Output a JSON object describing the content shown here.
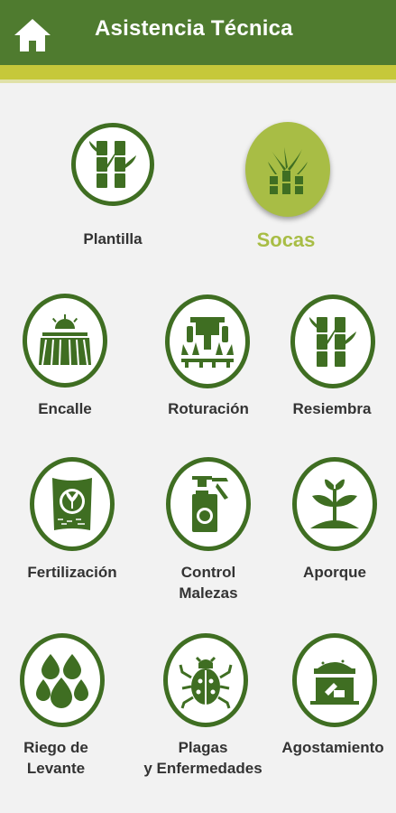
{
  "header": {
    "title": "Asistencia Técnica",
    "home_icon": "home-icon"
  },
  "colors": {
    "primary_green": "#4f7b2f",
    "icon_green": "#3f6e22",
    "accent_lime": "#c6c83a",
    "active_circle": "#a8bd45"
  },
  "menu": {
    "plantilla": {
      "label": "Plantilla",
      "icon": "sugarcane-icon"
    },
    "socas": {
      "label": "Socas",
      "icon": "sprout-cane-icon",
      "selected": true
    },
    "encalle": {
      "label": "Encalle",
      "icon": "field-rows-icon"
    },
    "roturacion": {
      "label": "Roturación",
      "icon": "tractor-icon"
    },
    "resiembra": {
      "label": "Resiembra",
      "icon": "sugarcane-icon"
    },
    "fertilizacion": {
      "label": "Fertilización",
      "icon": "fertilizer-bag-icon"
    },
    "control_malezas": {
      "label_line1": "Control",
      "label_line2": "Malezas",
      "icon": "sprayer-icon"
    },
    "aporque": {
      "label": "Aporque",
      "icon": "plant-mound-icon"
    },
    "riego": {
      "label_line1": "Riego de",
      "label_line2": "Levante",
      "icon": "water-drops-icon"
    },
    "plagas": {
      "label_line1": "Plagas",
      "label_line2": "y Enfermedades",
      "icon": "beetle-icon"
    },
    "agostamiento": {
      "label": "Agostamiento",
      "icon": "mortar-icon"
    }
  }
}
